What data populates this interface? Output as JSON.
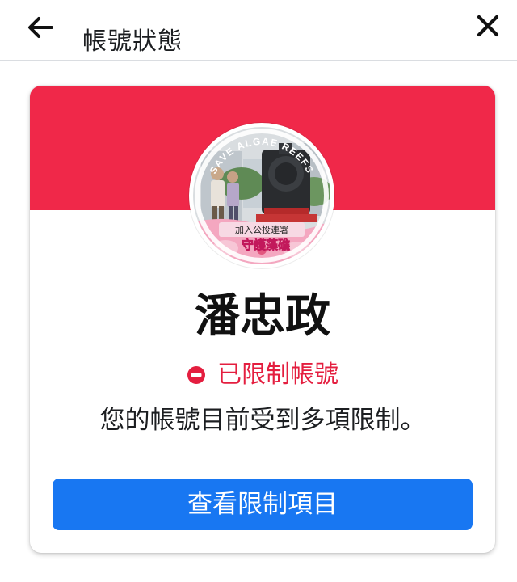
{
  "header": {
    "title": "帳號狀態",
    "back_icon": "arrow-left-icon",
    "close_icon": "close-icon"
  },
  "card": {
    "banner_color": "#f02849",
    "avatar": {
      "badge_top": "SAVE ALGAE REEFS",
      "badge_line1": "加入公投連署",
      "badge_line2": "守護藻礁"
    },
    "user_name": "潘忠政",
    "status": {
      "icon": "restricted-icon",
      "label": "已限制帳號",
      "color": "#e41e3f"
    },
    "description": "您的帳號目前受到多項限制。",
    "button": {
      "label": "查看限制項目",
      "color": "#1877f2"
    }
  }
}
